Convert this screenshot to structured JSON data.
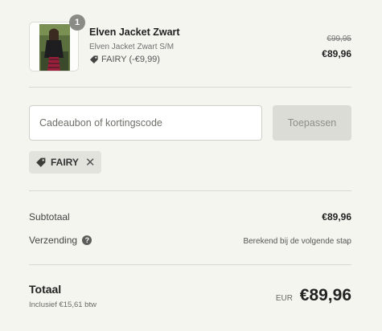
{
  "cart_item": {
    "quantity": "1",
    "title": "Elven Jacket Zwart",
    "variant": "Elven Jacket Zwart S/M",
    "discount": "FAIRY (-€9,99)",
    "price_original": "€99,95",
    "price_final": "€89,96"
  },
  "discount_form": {
    "placeholder": "Cadeaubon of kortingscode",
    "apply_label": "Toepassen",
    "applied_code": "FAIRY"
  },
  "summary": {
    "subtotal_label": "Subtotaal",
    "subtotal_value": "€89,96",
    "shipping_label": "Verzending",
    "shipping_value": "Berekend bij de volgende stap",
    "total_label": "Totaal",
    "tax_note": "Inclusief €15,61 btw",
    "currency": "EUR",
    "total_value": "€89,96"
  },
  "icons": {
    "tag": "tag-icon",
    "remove": "close-icon",
    "help": "question-circle-icon"
  },
  "colors": {
    "background": "#f5f5f0",
    "badge": "#8b8b86",
    "button_disabled": "#dcdcd6"
  }
}
